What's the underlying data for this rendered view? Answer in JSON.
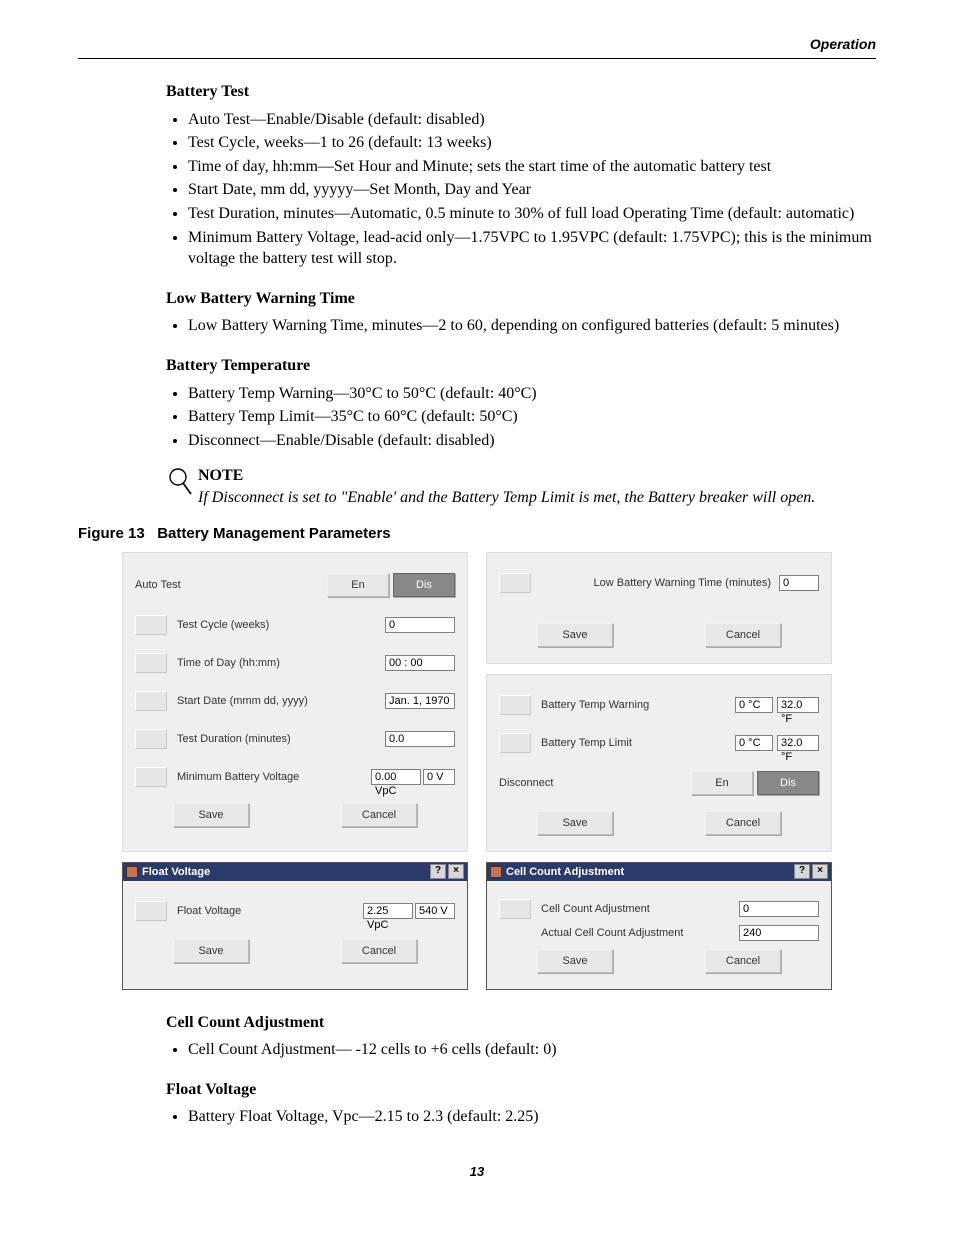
{
  "header": {
    "section": "Operation"
  },
  "battery_test": {
    "heading": "Battery Test",
    "items": [
      "Auto Test—Enable/Disable (default: disabled)",
      "Test Cycle, weeks—1 to 26 (default: 13 weeks)",
      "Time of day, hh:mm—Set Hour and Minute; sets the start time of the automatic battery test",
      "Start Date, mm dd, yyyyy—Set Month, Day and Year",
      "Test Duration, minutes—Automatic, 0.5 minute to 30% of full load Operating Time (default: automatic)",
      "Minimum Battery Voltage, lead-acid only—1.75VPC to 1.95VPC (default: 1.75VPC); this is the minimum voltage the battery test will stop."
    ]
  },
  "low_battery_warning_time": {
    "heading": "Low Battery Warning Time",
    "items": [
      "Low Battery Warning Time, minutes—2 to 60, depending on configured batteries (default: 5 minutes)"
    ]
  },
  "battery_temperature": {
    "heading": "Battery Temperature",
    "items": [
      "Battery Temp Warning—30°C to 50°C (default: 40°C)",
      "Battery Temp Limit—35°C to 60°C  (default: 50°C)",
      "Disconnect—Enable/Disable (default: disabled)"
    ]
  },
  "note": {
    "title": "NOTE",
    "text": "If Disconnect is set to \"Enable' and the Battery Temp Limit is met, the Battery breaker will open."
  },
  "figure": {
    "caption_label": "Figure 13",
    "caption_title": "Battery Management Parameters"
  },
  "ss": {
    "left_top": {
      "auto_test_label": "Auto Test",
      "en_btn": "En",
      "dis_btn": "Dis",
      "fields": {
        "test_cycle_label": "Test Cycle (weeks)",
        "test_cycle_value": "0",
        "time_of_day_label": "Time of Day (hh:mm)",
        "time_of_day_value": "00 : 00",
        "start_date_label": "Start Date (mmm dd, yyyy)",
        "start_date_value": "Jan. 1, 1970",
        "test_duration_label": "Test Duration (minutes)",
        "test_duration_value": "0.0",
        "min_batt_label": "Minimum Battery Voltage",
        "min_batt_vpc": "0.00 VpC",
        "min_batt_v": "0 V"
      },
      "save": "Save",
      "cancel": "Cancel"
    },
    "right_top": {
      "lbw_label": "Low Battery Warning Time (minutes)",
      "lbw_value": "0",
      "save": "Save",
      "cancel": "Cancel"
    },
    "right_mid": {
      "temp_warn_label": "Battery Temp Warning",
      "temp_warn_c": "0 °C",
      "temp_warn_f": "32.0 °F",
      "temp_limit_label": "Battery Temp Limit",
      "temp_limit_c": "0 °C",
      "temp_limit_f": "32.0 °F",
      "disconnect_label": "Disconnect",
      "en_btn": "En",
      "dis_btn": "Dis",
      "save": "Save",
      "cancel": "Cancel"
    },
    "float_dialog": {
      "title": "Float Voltage",
      "field_label": "Float Voltage",
      "vpc": "2.25 VpC",
      "v": "540 V",
      "save": "Save",
      "cancel": "Cancel"
    },
    "cell_dialog": {
      "title": "Cell Count Adjustment",
      "cca_label": "Cell Count Adjustment",
      "cca_value": "0",
      "acca_label": "Actual Cell Count Adjustment",
      "acca_value": "240",
      "save": "Save",
      "cancel": "Cancel"
    }
  },
  "cell_count": {
    "heading": "Cell Count Adjustment",
    "items": [
      "Cell Count Adjustment— -12 cells to +6 cells (default: 0)"
    ]
  },
  "float_voltage": {
    "heading": "Float Voltage",
    "items": [
      "Battery Float Voltage, Vpc—2.15 to 2.3 (default: 2.25)"
    ]
  },
  "page_number": "13"
}
